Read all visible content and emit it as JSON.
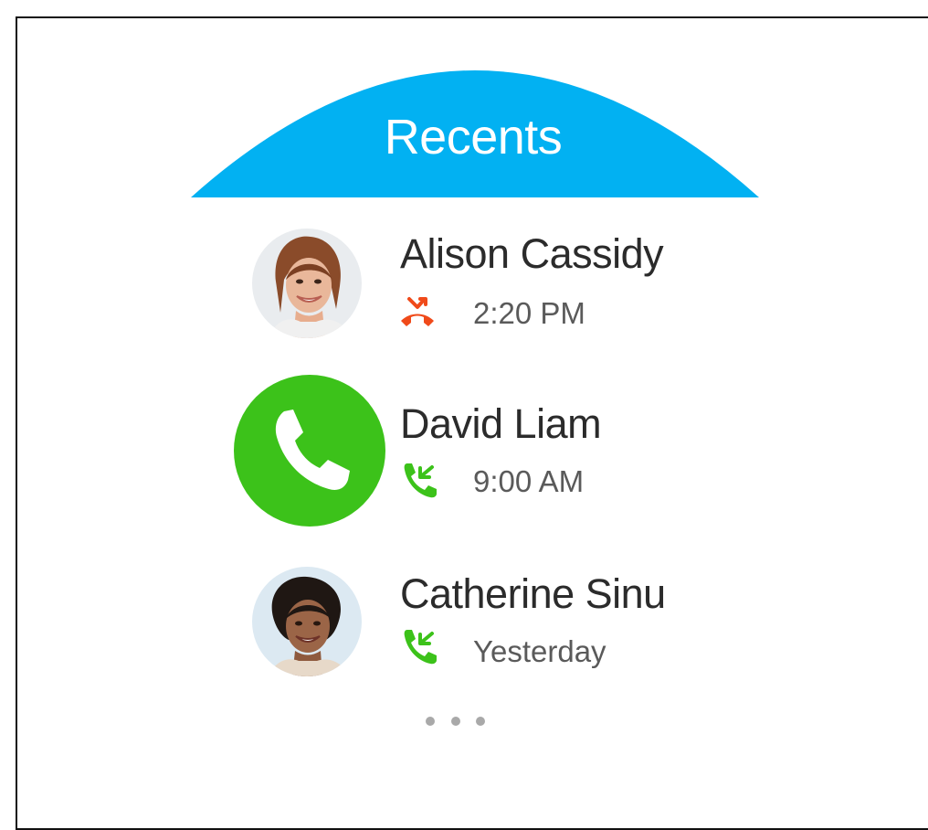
{
  "header": {
    "title": "Recents",
    "color": "#02b1f2"
  },
  "recents": [
    {
      "name": "Alison Cassidy",
      "time": "2:20 PM",
      "call_type_icon": "missed-call-icon",
      "status_color": "#f04a1a",
      "avatar": "avatar-photo-alison"
    },
    {
      "name": "David Liam",
      "time": "9:00 AM",
      "call_type_icon": "incoming-call-icon",
      "status_color": "#3cc21a",
      "action_icon": "phone-icon",
      "action_color": "#3cc21a"
    },
    {
      "name": "Catherine Sinu",
      "time": "Yesterday",
      "call_type_icon": "incoming-call-icon",
      "status_color": "#3cc21a",
      "avatar": "avatar-photo-catherine"
    }
  ],
  "more_icon": "more-dots-icon"
}
